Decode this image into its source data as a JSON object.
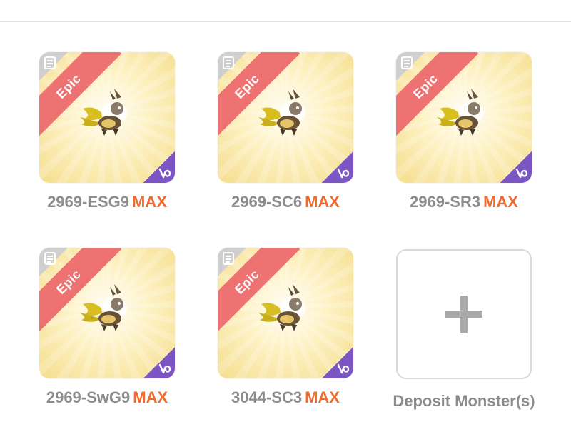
{
  "monsters": [
    {
      "rarity": "Epic",
      "code": "2969-ESG9",
      "level_tag": "MAX"
    },
    {
      "rarity": "Epic",
      "code": "2969-SC6",
      "level_tag": "MAX"
    },
    {
      "rarity": "Epic",
      "code": "2969-SR3",
      "level_tag": "MAX"
    },
    {
      "rarity": "Epic",
      "code": "2969-SwG9",
      "level_tag": "MAX"
    },
    {
      "rarity": "Epic",
      "code": "3044-SC3",
      "level_tag": "MAX"
    }
  ],
  "deposit": {
    "label": "Deposit Monster(s)",
    "icon": "plus-icon"
  },
  "icons": {
    "corner": "document-icon",
    "element": "element-badge-icon",
    "monster": "winged-griffin-monster"
  },
  "colors": {
    "rarity_epic": "#ef7272",
    "max_tag": "#f26a2c",
    "element_badge": "#7b55c4",
    "code_text": "#8c8c8c"
  }
}
